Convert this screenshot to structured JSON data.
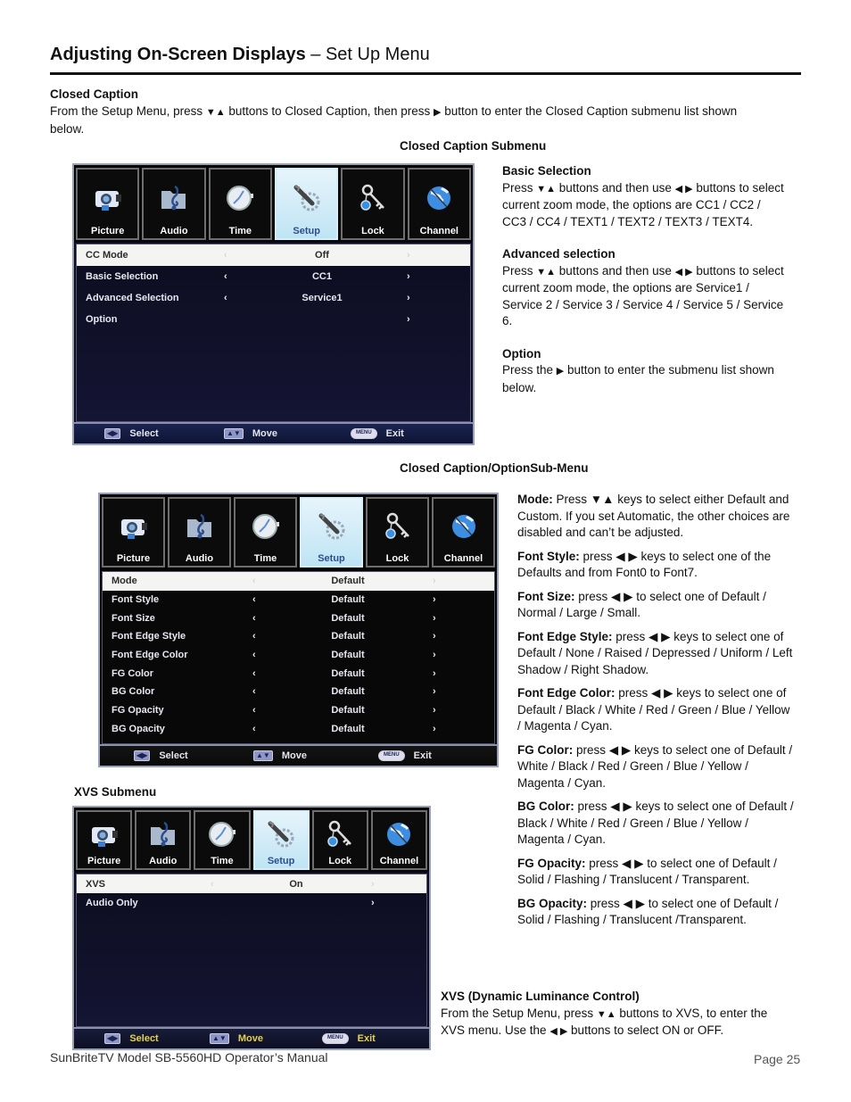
{
  "header": {
    "title_bold": "Adjusting On-Screen Displays",
    "title_rest": " – Set Up Menu"
  },
  "closed_caption": {
    "heading": "Closed Caption",
    "intro_a": "From the Setup Menu, press ",
    "intro_b": " buttons to Closed Caption, then press ",
    "intro_c": " button to enter the Closed Caption submenu list shown",
    "intro_d": "below.",
    "submenu_caption": "Closed Caption Submenu"
  },
  "glyphs": {
    "down_up": "▼▲",
    "left_right": "◀ ▶",
    "right": "▶"
  },
  "menu_tabs": [
    {
      "label": "Picture",
      "icon": "camera-icon"
    },
    {
      "label": "Audio",
      "icon": "music-folder-icon"
    },
    {
      "label": "Time",
      "icon": "clock-icon"
    },
    {
      "label": "Setup",
      "icon": "wrench-gear-icon",
      "active": true
    },
    {
      "label": "Lock",
      "icon": "key-icon"
    },
    {
      "label": "Channel",
      "icon": "globe-icon"
    }
  ],
  "cc_menu": {
    "rows": [
      {
        "name": "CC Mode",
        "value": "Off",
        "selected": true,
        "left_arrow": "‹",
        "right_arrow": "›"
      },
      {
        "name": "Basic Selection",
        "value": "CC1",
        "left_arrow": "‹",
        "right_arrow": "›"
      },
      {
        "name": "Advanced Selection",
        "value": "Service1",
        "left_arrow": "‹",
        "right_arrow": "›"
      },
      {
        "name": "Option",
        "value": "",
        "left_arrow": "",
        "right_arrow": "›"
      }
    ]
  },
  "bottom_bar": {
    "select_key": "◀▶",
    "select": "Select",
    "move_key": "▲▼",
    "move": "Move",
    "menu_key": "MENU",
    "exit": "Exit"
  },
  "cc_descriptions": [
    {
      "title": "Basic Selection",
      "line1a": "Press ",
      "line1b": " buttons and then use ",
      "line1c": " buttons",
      "rest": "to select current zoom mode, the options are CC1 / CC2 / CC3 / CC4 / TEXT1 / TEXT2 / TEXT3 / TEXT4."
    },
    {
      "title": "Advanced selection",
      "line1a": "Press ",
      "line1b": " buttons and then use ",
      "line1c": " buttons",
      "rest": "to select current zoom mode, the options are Service1 / Service 2 / Service 3 / Service 4 / Service 5 / Service 6."
    },
    {
      "title": "Option",
      "text_a": "Press the ",
      "text_b": " button to enter the submenu list shown below."
    }
  ],
  "option_submenu": {
    "caption": "Closed Caption/OptionSub-Menu",
    "rows": [
      {
        "name": "Mode",
        "value": "Default",
        "selected": true
      },
      {
        "name": "Font Style",
        "value": "Default"
      },
      {
        "name": "Font Size",
        "value": "Default"
      },
      {
        "name": "Font Edge Style",
        "value": "Default"
      },
      {
        "name": "Font Edge Color",
        "value": "Default"
      },
      {
        "name": "FG Color",
        "value": "Default"
      },
      {
        "name": "BG Color",
        "value": "Default"
      },
      {
        "name": "FG Opacity",
        "value": "Default"
      },
      {
        "name": "BG Opacity",
        "value": "Default"
      }
    ],
    "left_arrow": "‹",
    "right_arrow": "›"
  },
  "option_descriptions": [
    {
      "term": "Mode:",
      "text": " Press ▼▲ keys to select either Default and Custom. If you set Automatic, the other choices are disabled and can’t be adjusted."
    },
    {
      "term": "Font Style:",
      "text": " press ◀ ▶ keys to select one of the Defaults and from Font0 to Font7."
    },
    {
      "term": "Font Size:",
      "text": " press ◀ ▶ to select one of Default / Normal / Large / Small."
    },
    {
      "term": "Font Edge Style:",
      "text": " press ◀ ▶ keys to select one of Default / None / Raised / Depressed / Uniform / Left Shadow / Right Shadow."
    },
    {
      "term": "Font Edge Color:",
      "text": " press ◀ ▶ keys to select one of Default / Black / White / Red / Green / Blue / Yellow / Magenta / Cyan."
    },
    {
      "term": "FG Color:",
      "text": " press ◀ ▶ keys to select one of Default / White / Black / Red / Green / Blue / Yellow / Magenta / Cyan."
    },
    {
      "term": "BG Color:",
      "text": " press ◀ ▶ keys to select one of Default / Black / White / Red / Green / Blue / Yellow / Magenta / Cyan."
    },
    {
      "term": "FG Opacity:",
      "text": " press ◀ ▶ to select one of Default / Solid / Flashing / Translucent / Transparent."
    },
    {
      "term": "BG Opacity:",
      "text": " press ◀ ▶ to select one of Default / Solid / Flashing / Translucent /Transparent."
    }
  ],
  "xvs_submenu": {
    "caption": "XVS Submenu",
    "rows": [
      {
        "name": "XVS",
        "value": "On",
        "selected": true,
        "left_arrow": "‹",
        "right_arrow": "›"
      },
      {
        "name": "Audio Only",
        "value": "",
        "left_arrow": "",
        "right_arrow": "›"
      }
    ]
  },
  "xvs_description": {
    "title": "XVS (Dynamic Luminance Control)",
    "line1a": "From the Setup Menu, press ",
    "line1b": " buttons to XVS, to enter the",
    "line2a": "XVS menu. Use the ",
    "line2b": " buttons to select ON or OFF."
  },
  "footer": {
    "manual": "SunBriteTV Model SB-5560HD Operator’s Manual",
    "page": "Page 25"
  }
}
